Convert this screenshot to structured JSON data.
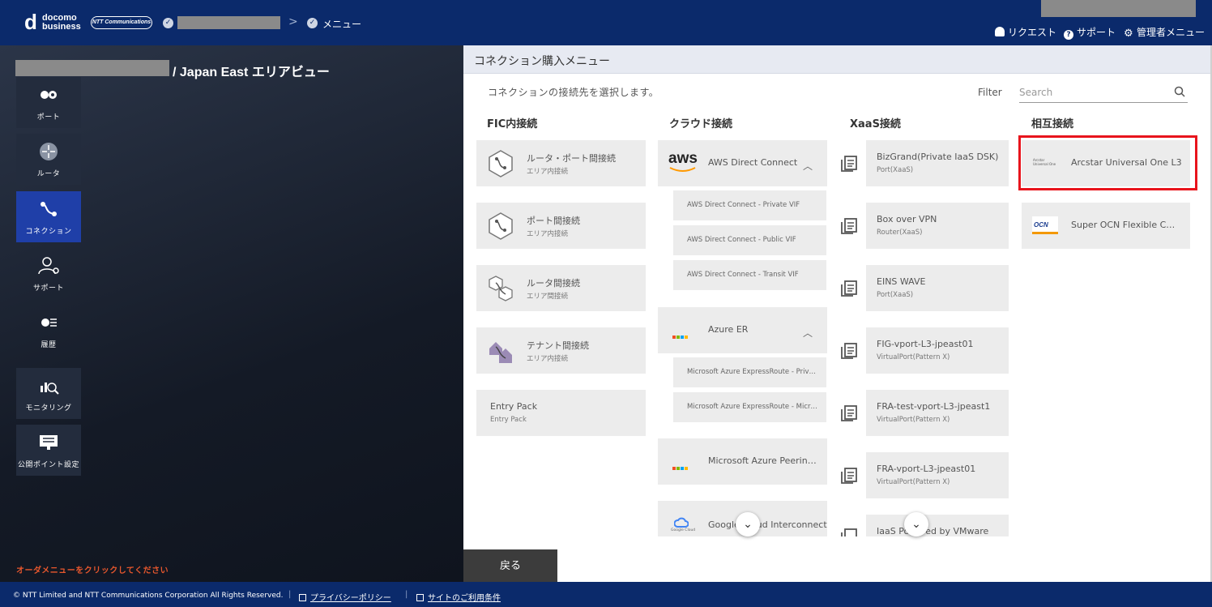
{
  "header": {
    "logo_docomo": "docomo",
    "logo_business": "business",
    "logo_ntt": "NTT Communications",
    "crumb_separator": ">",
    "crumb_menu": "メニュー",
    "links": {
      "request": "リクエスト",
      "support": "サポート",
      "admin_menu": "管理者メニュー"
    }
  },
  "area_title": "/ Japan East エリアビュー",
  "sidenav": [
    {
      "label": "ポート",
      "icon": "port-icon"
    },
    {
      "label": "ルータ",
      "icon": "router-icon"
    },
    {
      "label": "コネクション",
      "icon": "connection-icon",
      "active": true
    },
    {
      "label": "サポート",
      "icon": "support-icon"
    },
    {
      "label": "履歴",
      "icon": "history-icon"
    },
    {
      "label": "モニタリング",
      "icon": "monitoring-icon"
    },
    {
      "label": "公開ポイント設定",
      "icon": "public-point-icon"
    }
  ],
  "order_message": "オーダメニューをクリックしてください",
  "back_button": "戻る",
  "panel": {
    "title": "コネクション購入メニュー",
    "description": "コネクションの接続先を選択します。",
    "filter_label": "Filter",
    "search_placeholder": "Search",
    "columns": {
      "fic": {
        "heading": "FIC内接続",
        "cards": [
          {
            "title": "ルータ・ポート間接続",
            "sub": "エリア内接続"
          },
          {
            "title": "ポート間接続",
            "sub": "エリア内接続"
          },
          {
            "title": "ルータ間接続",
            "sub": "エリア間接続"
          },
          {
            "title": "テナント間接続",
            "sub": "エリア内接続"
          },
          {
            "title": "Entry Pack",
            "sub": "Entry Pack"
          }
        ]
      },
      "cloud": {
        "heading": "クラウド接続",
        "aws": {
          "logo": "aws",
          "title": "AWS Direct Connect",
          "subs": [
            "AWS Direct Connect - Private VIF",
            "AWS Direct Connect - Public VIF",
            "AWS Direct Connect - Transit VIF"
          ]
        },
        "azure": {
          "title": "Azure ER",
          "subs": [
            "Microsoft Azure ExpressRoute - Private Peering",
            "Microsoft Azure ExpressRoute - Microsoft Peering"
          ]
        },
        "azure_peering": {
          "title": "Microsoft Azure Peering Service"
        },
        "google": {
          "title": "Google Cloud Interconnect",
          "logo_text": "Google Cloud"
        }
      },
      "xaas": {
        "heading": "XaaS接続",
        "cards": [
          {
            "title": "BizGrand(Private IaaS DSK)",
            "sub": "Port(XaaS)"
          },
          {
            "title": "Box over VPN",
            "sub": "Router(XaaS)"
          },
          {
            "title": "EINS WAVE",
            "sub": "Port(XaaS)"
          },
          {
            "title": "FIG-vport-L3-jpeast01",
            "sub": "VirtualPort(Pattern X)"
          },
          {
            "title": "FRA-test-vport-L3-jpeast1",
            "sub": "VirtualPort(Pattern X)"
          },
          {
            "title": "FRA-vport-L3-jpeast01",
            "sub": "VirtualPort(Pattern X)"
          },
          {
            "title": "IaaS Powered by VMware",
            "sub": ""
          }
        ]
      },
      "mutual": {
        "heading": "相互接続",
        "cards": [
          {
            "title": "Arcstar Universal One L3",
            "logo": "Arcstar Universal One"
          },
          {
            "title": "Super OCN Flexible Connect",
            "logo": "OCN"
          }
        ]
      }
    }
  },
  "footer": {
    "copyright": "© NTT Limited and NTT Communications Corporation All Rights Reserved.",
    "privacy": "プライバシーポリシー",
    "terms": "サイトのご利用条件"
  },
  "colors": {
    "header_bg": "#0b2a6b",
    "active_nav": "#1f3fa8",
    "card_bg": "#ececec",
    "highlight": "#e8141c",
    "order_msg": "#e8572d"
  }
}
